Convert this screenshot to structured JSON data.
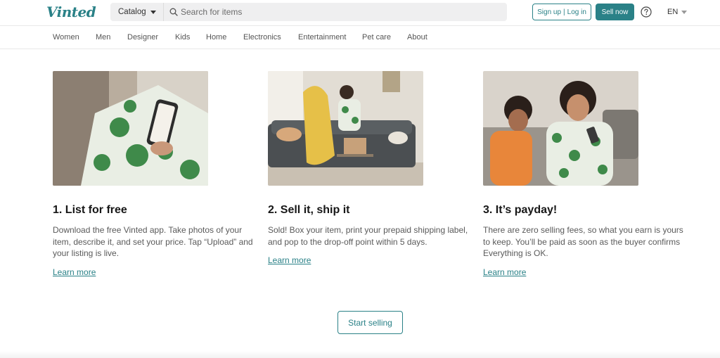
{
  "header": {
    "logo": "Vinted",
    "catalog_label": "Catalog",
    "search_placeholder": "Search for items",
    "signup_label": "Sign up",
    "login_label": "Log in",
    "signup_separator": "|",
    "sell_now_label": "Sell now",
    "language": "EN",
    "help_icon": "question-circle-icon",
    "search_icon": "magnifier-icon"
  },
  "nav": {
    "items": [
      {
        "label": "Women"
      },
      {
        "label": "Men"
      },
      {
        "label": "Designer"
      },
      {
        "label": "Kids"
      },
      {
        "label": "Home"
      },
      {
        "label": "Electronics"
      },
      {
        "label": "Entertainment"
      },
      {
        "label": "Pet care"
      },
      {
        "label": "About"
      }
    ]
  },
  "steps": [
    {
      "title": "1. List for free",
      "text": "Download the free Vinted app. Take photos of your item, describe it, and set your price. Tap “Upload” and your listing is live.",
      "link": "Learn more"
    },
    {
      "title": "2. Sell it, ship it",
      "text": "Sold! Box your item, print your prepaid shipping label, and pop to the drop-off point within 5 days.",
      "link": "Learn more"
    },
    {
      "title": "3. It’s payday!",
      "text": "There are zero selling fees, so what you earn is yours to keep. You’ll be paid as soon as the buyer confirms Everything is OK.",
      "link": "Learn more"
    }
  ],
  "cta": {
    "start_selling_label": "Start selling"
  },
  "colors": {
    "brand": "#2a8187",
    "text": "#171717",
    "muted_text": "#5a5a5a"
  }
}
